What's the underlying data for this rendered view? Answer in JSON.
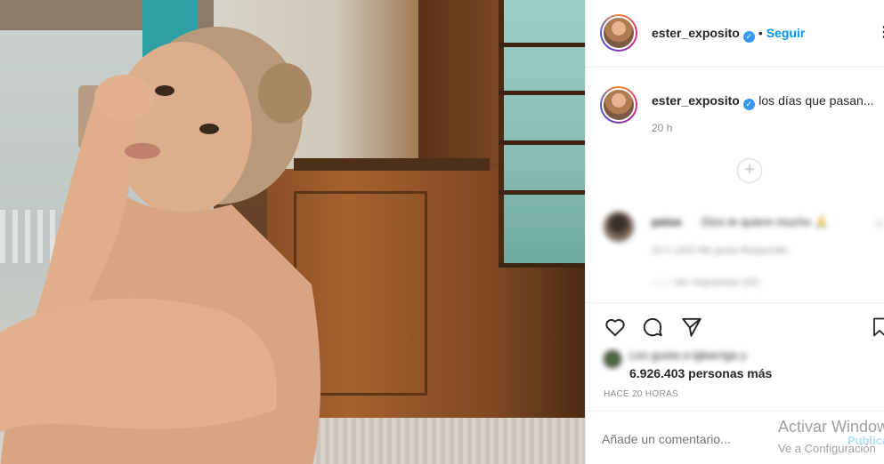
{
  "post": {
    "username": "ester_exposito",
    "follow_label": "Seguir",
    "separator": "•",
    "more_glyph": "⋮"
  },
  "caption": {
    "username": "ester_exposito",
    "text": "los días que pasan...",
    "time": "20 h"
  },
  "load_more_glyph": "+",
  "comment": {
    "username": "paisa",
    "text": "Dios te quiere mucho 🙏",
    "meta": "20 h   1400 Me gusta   Responder",
    "replies": "—— Ver respuestas (20)",
    "like_glyph": "♡"
  },
  "likes": {
    "liked_by": "Les gusta a lgbarriga y",
    "count": "6.926.403 personas más"
  },
  "timeago": "HACE 20 HORAS",
  "comment_input": {
    "placeholder": "Añade un comentario...",
    "publish_label": "Publicar"
  },
  "watermark": {
    "line1": "Activar Windows",
    "line2": "Ve a Configuración"
  },
  "colors": {
    "accent": "#0095f6",
    "verified": "#3897f0",
    "muted": "#8e8e8e"
  },
  "icons": [
    "verified-icon",
    "heart-icon",
    "comment-icon",
    "share-icon",
    "bookmark-icon",
    "add-circle-icon",
    "more-icon"
  ]
}
